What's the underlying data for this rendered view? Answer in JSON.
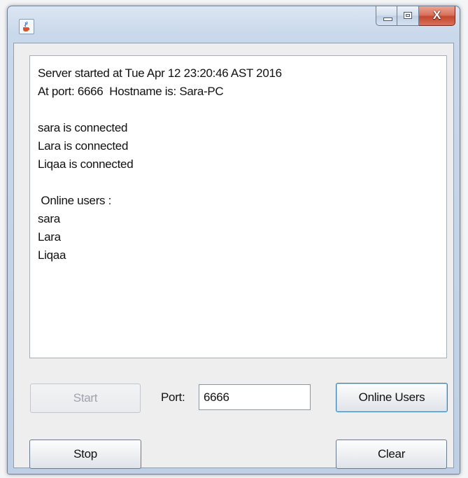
{
  "window": {
    "title": "",
    "icon": "java-cup-icon",
    "caption_buttons": {
      "minimize": "minimize-icon",
      "maximize": "maximize-icon",
      "close": "X"
    }
  },
  "log": {
    "lines": [
      "Server started at Tue Apr 12 23:20:46 AST 2016",
      "At port: 6666  Hostname is: Sara-PC",
      "",
      "sara is connected",
      "Lara is connected",
      "Liqaa is connected",
      "",
      " Online users :",
      "sara",
      "Lara",
      "Liqaa"
    ]
  },
  "controls": {
    "start_label": "Start",
    "port_label": "Port:",
    "port_value": "6666",
    "online_users_label": "Online Users",
    "stop_label": "Stop",
    "clear_label": "Clear"
  },
  "colors": {
    "close_button": "#c4492e",
    "window_frame": "#bfd0e4",
    "client_bg": "#eeeeee"
  }
}
